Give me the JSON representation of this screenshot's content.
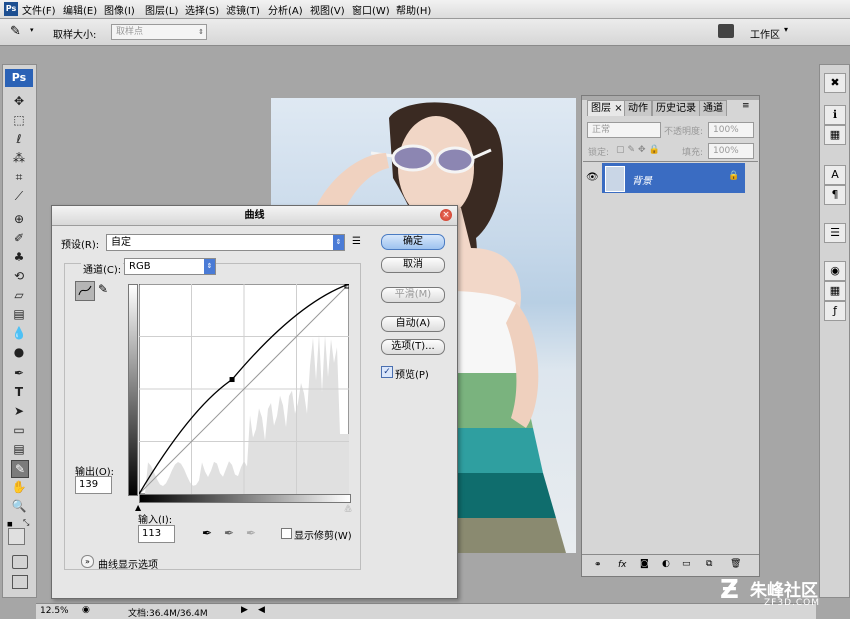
{
  "menubar": {
    "app_icon": "Ps",
    "items": [
      "文件(F)",
      "编辑(E)",
      "图像(I)",
      "图层(L)",
      "选择(S)",
      "滤镜(T)",
      "分析(A)",
      "视图(V)",
      "窗口(W)",
      "帮助(H)"
    ]
  },
  "optionsbar": {
    "sample_size_label": "取样大小:",
    "sample_size_value": "取样点",
    "workspace_label": "工作区"
  },
  "toolbox": {
    "logo": "Ps",
    "tools": [
      "move-icon",
      "marquee-icon",
      "lasso-icon",
      "magic-wand-icon",
      "crop-icon",
      "eyedropper-icon",
      "healing-icon",
      "brush-icon",
      "stamp-icon",
      "history-brush-icon",
      "eraser-icon",
      "gradient-icon",
      "blur-icon",
      "dodge-icon",
      "pen-icon",
      "type-icon",
      "path-select-icon",
      "shape-icon",
      "notes-icon",
      "color-sampler-icon",
      "hand-icon",
      "zoom-icon"
    ],
    "type_glyph": "T"
  },
  "layers_panel": {
    "tabs": [
      "图层",
      "动作",
      "历史记录",
      "通道"
    ],
    "blend_mode": "正常",
    "opacity_label": "不透明度:",
    "opacity_value": "100%",
    "lock_label": "锁定:",
    "fill_label": "填充:",
    "fill_value": "100%",
    "layers": [
      {
        "name": "背景",
        "selected": true
      }
    ]
  },
  "status": {
    "zoom": "12.5%",
    "doc_info": "文档:36.4M/36.4M"
  },
  "curves_dialog": {
    "title": "曲线",
    "preset_label": "预设(R):",
    "preset_value": "自定",
    "channel_label": "通道(C):",
    "channel_value": "RGB",
    "buttons": {
      "ok": "确定",
      "cancel": "取消",
      "smooth": "平滑(M)",
      "auto": "自动(A)",
      "options": "选项(T)..."
    },
    "preview_label": "预览(P)",
    "preview_checked": true,
    "output_label": "输出(O):",
    "output_value": "139",
    "input_label": "输入(I):",
    "input_value": "113",
    "show_clipping_label": "显示修剪(W)",
    "curve_display_options_label": "曲线显示选项",
    "curve_point": {
      "input": 113,
      "output": 139
    }
  },
  "watermark": {
    "text": "朱峰社区",
    "subtext": "ZF3D.COM"
  },
  "colors": {
    "accent": "#2b62b6",
    "selected_layer": "#3a6cc2"
  }
}
